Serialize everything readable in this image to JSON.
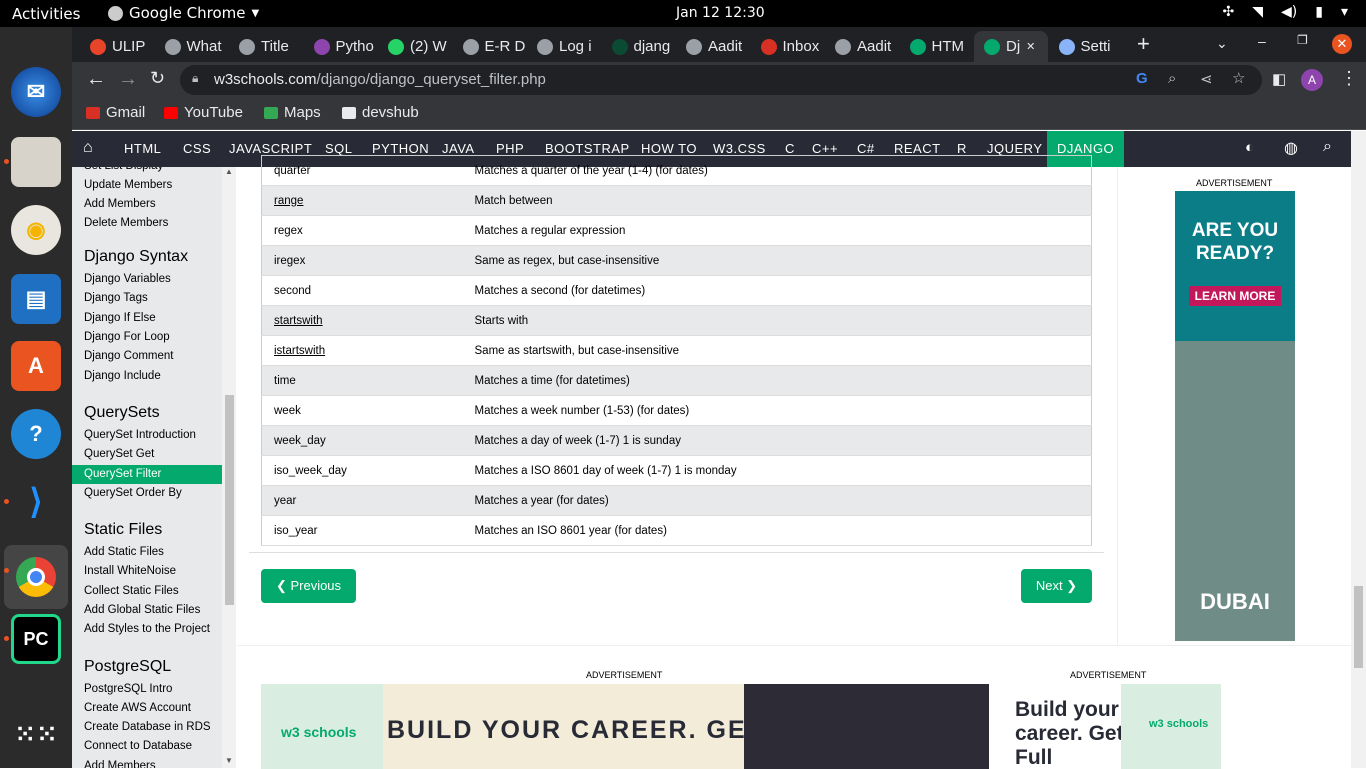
{
  "system": {
    "activities": "Activities",
    "app_name": "Google Chrome",
    "clock": "Jan 12  12:30"
  },
  "tabs": [
    {
      "label": "ULIP",
      "color": "#e8442a"
    },
    {
      "label": "What",
      "color": "#9aa0a6"
    },
    {
      "label": "Title",
      "color": "#9aa0a6"
    },
    {
      "label": "Pytho",
      "color": "#8e44ad"
    },
    {
      "label": "(2) W",
      "color": "#25d366"
    },
    {
      "label": "E-R D",
      "color": "#9aa0a6"
    },
    {
      "label": "Log i",
      "color": "#9aa0a6"
    },
    {
      "label": "djang",
      "color": "#0c4b33"
    },
    {
      "label": "Aadit",
      "color": "#9aa0a6"
    },
    {
      "label": "Inbox",
      "color": "#d93025"
    },
    {
      "label": "Aadit",
      "color": "#9aa0a6"
    },
    {
      "label": "HTM",
      "color": "#04aa6d"
    },
    {
      "label": "Dj",
      "color": "#04aa6d"
    },
    {
      "label": "Setti",
      "color": "#8ab4f8"
    }
  ],
  "address": {
    "host": "w3schools.com",
    "path": "/django/django_queryset_filter.php"
  },
  "bookmarks": [
    {
      "label": "Gmail",
      "color": "#d93025"
    },
    {
      "label": "YouTube",
      "color": "#ff0000"
    },
    {
      "label": "Maps",
      "color": "#34a853"
    },
    {
      "label": "devshub",
      "color": "#e8eaed"
    }
  ],
  "nav": [
    "HTML",
    "CSS",
    "JAVASCRIPT",
    "SQL",
    "PYTHON",
    "JAVA",
    "PHP",
    "BOOTSTRAP",
    "HOW TO",
    "W3.CSS",
    "C",
    "C++",
    "C#",
    "REACT",
    "R",
    "JQUERY",
    "DJANGO"
  ],
  "sidebar": {
    "top_links": [
      "Set List Display",
      "Update Members",
      "Add Members",
      "Delete Members"
    ],
    "sections": [
      {
        "heading": "Django Syntax",
        "links": [
          "Django Variables",
          "Django Tags",
          "Django If Else",
          "Django For Loop",
          "Django Comment",
          "Django Include"
        ]
      },
      {
        "heading": "QuerySets",
        "links": [
          "QuerySet Introduction",
          "QuerySet Get",
          "QuerySet Filter",
          "QuerySet Order By"
        ]
      },
      {
        "heading": "Static Files",
        "links": [
          "Add Static Files",
          "Install WhiteNoise",
          "Collect Static Files",
          "Add Global Static Files",
          "Add Styles to the Project"
        ]
      },
      {
        "heading": "PostgreSQL",
        "links": [
          "PostgreSQL Intro",
          "Create AWS Account",
          "Create Database in RDS",
          "Connect to Database",
          "Add Members"
        ]
      }
    ],
    "active": "QuerySet Filter"
  },
  "table": [
    {
      "key": "quarter",
      "desc": "Matches a quarter of the year (1-4) (for dates)"
    },
    {
      "key": "range",
      "desc": "Match between",
      "link": true
    },
    {
      "key": "regex",
      "desc": "Matches a regular expression"
    },
    {
      "key": "iregex",
      "desc": "Same as regex, but case-insensitive"
    },
    {
      "key": "second",
      "desc": "Matches a second (for datetimes)"
    },
    {
      "key": "startswith",
      "desc": "Starts with",
      "link": true
    },
    {
      "key": "istartswith",
      "desc": "Same as startswith, but case-insensitive",
      "link": true
    },
    {
      "key": "time",
      "desc": "Matches a time (for datetimes)"
    },
    {
      "key": "week",
      "desc": "Matches a week number (1-53) (for dates)"
    },
    {
      "key": "week_day",
      "desc": "Matches a day of week (1-7) 1 is sunday"
    },
    {
      "key": "iso_week_day",
      "desc": "Matches a ISO 8601 day of week (1-7) 1 is monday"
    },
    {
      "key": "year",
      "desc": "Matches a year (for dates)"
    },
    {
      "key": "iso_year",
      "desc": "Matches an ISO 8601 year (for dates)"
    }
  ],
  "pager": {
    "prev": "❮ Previous",
    "next": "Next ❯"
  },
  "ads": {
    "label": "ADVERTISEMENT",
    "right_headline": "ARE YOU READY?",
    "right_cta": "LEARN MORE",
    "right_brand": "DUBAI",
    "bottom1_text": "BUILD YOUR CAREER. GET",
    "bottom2_text": "Build your career. Get Full Access.",
    "w3_logo": "w3 schools"
  }
}
